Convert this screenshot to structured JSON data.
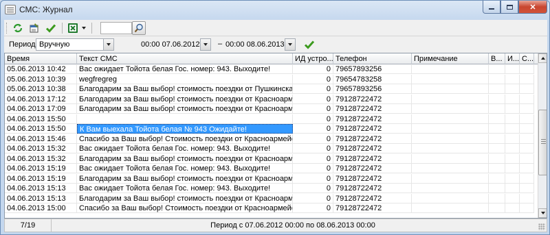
{
  "window": {
    "title": "СМС: Журнал"
  },
  "toolbar": {
    "search_value": ""
  },
  "filter": {
    "period_label": "Период",
    "period_mode": "Вручную",
    "date_from": "00:00 07.06.2012",
    "separator": "–",
    "date_to": "00:00 08.06.2013"
  },
  "grid": {
    "columns": [
      "Время",
      "Текст СМС",
      "ИД устро...",
      "Телефон",
      "Примечание",
      "В...",
      "И...",
      "С..."
    ],
    "rows": [
      {
        "time": "05.06.2013 10:42",
        "text": "Вас ожидает Тойота белая Гос. номер: 943. Выходите!",
        "device": "0",
        "phone": "79657893256",
        "note": ""
      },
      {
        "time": "05.06.2013 10:39",
        "text": "wegfregreg",
        "device": "0",
        "phone": "79654783258",
        "note": ""
      },
      {
        "time": "05.06.2013 10:38",
        "text": "Благодарим за Ваш выбор! стоимость поездки от Пушкинская у...",
        "device": "0",
        "phone": "79657893256",
        "note": ""
      },
      {
        "time": "04.06.2013 17:12",
        "text": "Благодарим за Ваш выбор! стоимость поездки от Красноармей...",
        "device": "0",
        "phone": "79128722472",
        "note": ""
      },
      {
        "time": "04.06.2013 17:09",
        "text": "Благодарим за Ваш выбор! стоимость поездки от Красноармей...",
        "device": "0",
        "phone": "79128722472",
        "note": ""
      },
      {
        "time": "04.06.2013 15:50",
        "text": "",
        "device": "0",
        "phone": "79128722472",
        "note": ""
      },
      {
        "time": "04.06.2013 15:50",
        "text": "К Вам выехала Тойота белая №  943 Ожидайте!",
        "device": "0",
        "phone": "79128722472",
        "note": "",
        "selected": true
      },
      {
        "time": "04.06.2013 15:46",
        "text": "Спасибо за Ваш выбор! Стоимость поездки от Красноармейска...",
        "device": "0",
        "phone": "79128722472",
        "note": ""
      },
      {
        "time": "04.06.2013 15:32",
        "text": "Вас ожидает Тойота белая Гос. номер: 943. Выходите!",
        "device": "0",
        "phone": "79128722472",
        "note": ""
      },
      {
        "time": "04.06.2013 15:32",
        "text": "Благодарим за Ваш выбор! стоимость поездки от Красноармей...",
        "device": "0",
        "phone": "79128722472",
        "note": ""
      },
      {
        "time": "04.06.2013 15:19",
        "text": "Вас ожидает Тойота белая Гос. номер: 943. Выходите!",
        "device": "0",
        "phone": "79128722472",
        "note": ""
      },
      {
        "time": "04.06.2013 15:19",
        "text": "Благодарим за Ваш выбор! стоимость поездки от Красноармей...",
        "device": "0",
        "phone": "79128722472",
        "note": ""
      },
      {
        "time": "04.06.2013 15:13",
        "text": "Вас ожидает Тойота белая Гос. номер: 943. Выходите!",
        "device": "0",
        "phone": "79128722472",
        "note": ""
      },
      {
        "time": "04.06.2013 15:13",
        "text": "Благодарим за Ваш выбор! стоимость поездки от Красноармей...",
        "device": "0",
        "phone": "79128722472",
        "note": ""
      },
      {
        "time": "04.06.2013 15:00",
        "text": "Спасибо за Ваш выбор! Стоимость поездки от Красноармейска...",
        "device": "0",
        "phone": "79128722472",
        "note": ""
      }
    ]
  },
  "status": {
    "count": "7/19",
    "period": "Период с 07.06.2012 00:00 по 08.06.2013 00:00"
  },
  "colors": {
    "selection": "#3399ff",
    "close_button": "#c8452f"
  },
  "icons": [
    "refresh-icon",
    "properties-icon",
    "checkmark-icon",
    "excel-icon",
    "dropdown-arrow-icon",
    "search-icon",
    "apply-check-icon"
  ]
}
